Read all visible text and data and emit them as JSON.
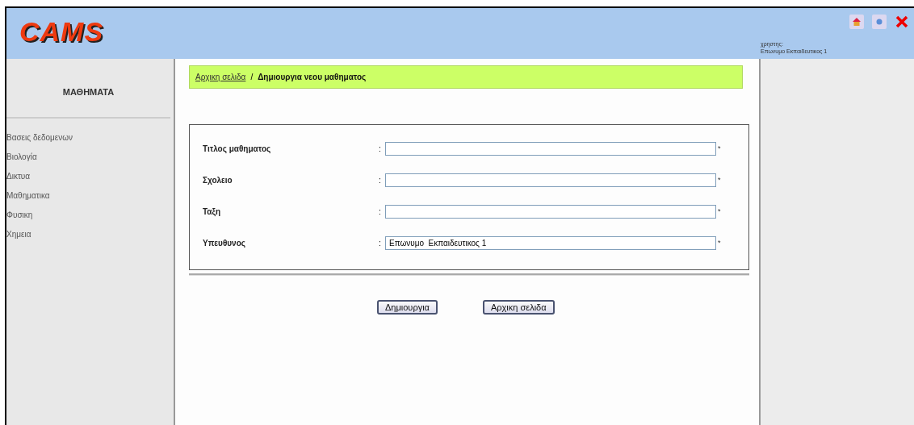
{
  "header": {
    "logo": "CAMS",
    "user_label": "χρηστης:",
    "user_name": "Επωνυμο Εκπαιδευτικος 1"
  },
  "sidebar": {
    "title": "ΜΑΘΗΜΑΤΑ",
    "items": [
      "Βασεις δεδομενων",
      "Βιολογία",
      "Δικτυα",
      "Μαθηματικα",
      "Φυσικη",
      "Χημεια"
    ]
  },
  "breadcrumb": {
    "link": "Αρχικη σελιδα",
    "separator": "/",
    "current": "Δημιουργια νεου μαθηματος"
  },
  "form": {
    "fields": [
      {
        "label": "Τιτλος μαθηματος",
        "colon": ":",
        "required": "*"
      },
      {
        "label": "Σχολειο",
        "colon": ":",
        "required": "*"
      },
      {
        "label": "Ταξη",
        "colon": ":",
        "required": "*"
      },
      {
        "label": "Υπευθυνος",
        "colon": ":",
        "value": "Επωνυμο  Εκπαιδευτικος 1",
        "required": "*"
      }
    ]
  },
  "buttons": [
    "Δημιουργια",
    "Αρχικη σελιδα"
  ]
}
